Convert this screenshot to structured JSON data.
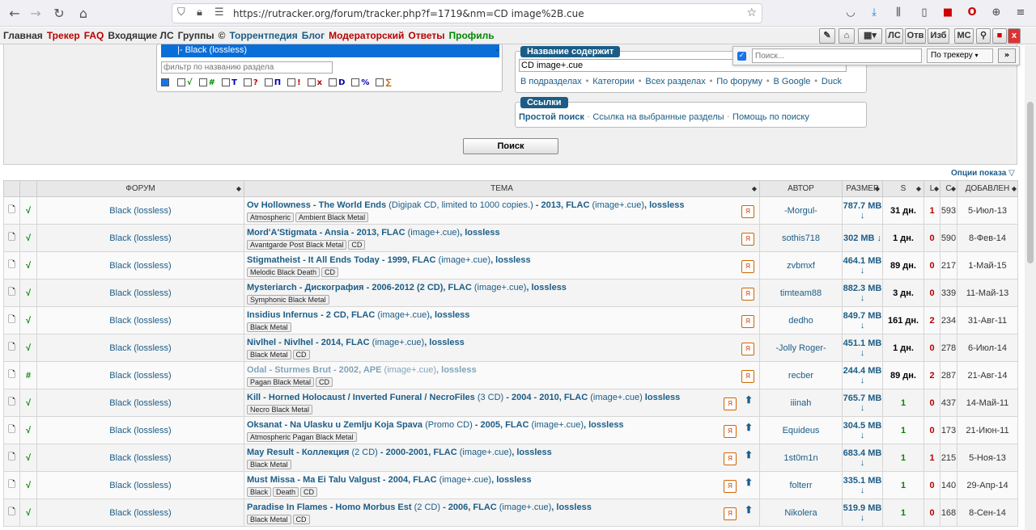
{
  "browser": {
    "url": "https://rutracker.org/forum/tracker.php?f=1719&nm=CD image%2B.cue"
  },
  "menu": {
    "items": [
      {
        "label": "Главная",
        "color": "#333"
      },
      {
        "label": "Трекер",
        "color": "#b00"
      },
      {
        "label": "FAQ",
        "color": "#b00"
      },
      {
        "label": "Входящие ЛС",
        "color": "#333"
      },
      {
        "label": "Группы",
        "color": "#333"
      },
      {
        "label": "©",
        "color": "#333"
      },
      {
        "label": "Торрентпедия",
        "color": "#1b5d87"
      },
      {
        "label": "Блог",
        "color": "#1b5d87"
      },
      {
        "label": "Модераторский",
        "color": "#b00"
      },
      {
        "label": "Ответы",
        "color": "#b00"
      },
      {
        "label": "Профиль",
        "color": "#080"
      }
    ],
    "buttons": [
      "ЛС",
      "Отв",
      "Изб",
      "МС"
    ]
  },
  "popup": {
    "placeholder": "Поиск...",
    "scope": "По трекеру",
    "go": "»"
  },
  "search": {
    "selected_forum": "|- Black (lossless)",
    "filter_placeholder": "фильтр по названию раздела",
    "flags": [
      {
        "sym": "*",
        "color": "#b00"
      },
      {
        "sym": "√",
        "color": "#080"
      },
      {
        "sym": "#",
        "color": "#080"
      },
      {
        "sym": "T",
        "color": "#00a"
      },
      {
        "sym": "?",
        "color": "#b00"
      },
      {
        "sym": "П",
        "color": "#00a"
      },
      {
        "sym": "!",
        "color": "#b00"
      },
      {
        "sym": "x",
        "color": "#b00"
      },
      {
        "sym": "D",
        "color": "#00a"
      },
      {
        "sym": "%",
        "color": "#00a"
      },
      {
        "sym": "∑",
        "color": "#c60"
      }
    ],
    "title_legend": "Название содержит",
    "title_value": "CD image+.cue",
    "title_links": [
      "В подразделах",
      "Категории",
      "Всех разделах",
      "По форуму",
      "В Google",
      "Duck"
    ],
    "links_legend": "Ссылки",
    "simple_search": "Простой поиск",
    "link2": "Ссылка на выбранные разделы",
    "link3": "Помощь по поиску",
    "submit": "Поиск",
    "options": "Опции показа"
  },
  "table": {
    "headers": {
      "forum": "ФОРУМ",
      "topic": "ТЕМА",
      "author": "АВТОР",
      "size": "РАЗМЕР",
      "s": "S",
      "l": "L",
      "c": "C",
      "added": "ДОБАВЛЕН"
    },
    "rows": [
      {
        "check": "√",
        "forum": "Black (lossless)",
        "title": "Ov Hollowness - The World Ends",
        "extra": " (Digipak CD, limited to 1000 copies.)",
        "tail": " - 2013, FLAC ",
        "fmt": "(image+.cue)",
        "q": ", lossless",
        "tags": [
          "Atmospheric",
          "Ambient Black Metal"
        ],
        "up": false,
        "author": "-Morgul-",
        "size": "787.7 MB ↓",
        "seed": "31 дн.",
        "leech": "1",
        "comp": "593",
        "added": "5-Июл-13",
        "seedcolor": "#000"
      },
      {
        "check": "√",
        "forum": "Black (lossless)",
        "title": "Mord'A'Stigmata - Ansia",
        "extra": "",
        "tail": " - 2013, FLAC ",
        "fmt": "(image+.cue)",
        "q": ", lossless",
        "tags": [
          "Avantgarde Post Black Metal",
          "CD"
        ],
        "up": false,
        "author": "sothis718",
        "size": "302 MB ↓",
        "seed": "1 дн.",
        "leech": "0",
        "comp": "590",
        "added": "8-Фев-14",
        "seedcolor": "#000"
      },
      {
        "check": "√",
        "forum": "Black (lossless)",
        "title": "Stigmatheist - It All Ends Today",
        "extra": "",
        "tail": " - 1999, FLAC ",
        "fmt": "(image+.cue)",
        "q": ", lossless",
        "tags": [
          "Melodic Black Death",
          "CD"
        ],
        "up": false,
        "author": "zvbmxf",
        "size": "464.1 MB ↓",
        "seed": "89 дн.",
        "leech": "0",
        "comp": "217",
        "added": "1-Май-15",
        "seedcolor": "#000"
      },
      {
        "check": "√",
        "forum": "Black (lossless)",
        "title": "Mysteriarch - Дискография",
        "extra": "",
        "tail": " - 2006-2012 (2 CD), FLAC ",
        "fmt": "(image+.cue)",
        "q": ", lossless",
        "tags": [
          "Symphonic Black Metal"
        ],
        "up": false,
        "author": "timteam88",
        "size": "882.3 MB ↓",
        "seed": "3 дн.",
        "leech": "0",
        "comp": "339",
        "added": "11-Май-13",
        "seedcolor": "#000"
      },
      {
        "check": "√",
        "forum": "Black (lossless)",
        "title": "Insidius Infernus - 2 CD, FLAC",
        "extra": "",
        "tail": " ",
        "fmt": "(image+.cue)",
        "q": ", lossless",
        "tags": [
          "Black Metal"
        ],
        "up": false,
        "author": "dedho",
        "size": "849.7 MB ↓",
        "seed": "161 дн.",
        "leech": "2",
        "comp": "234",
        "added": "31-Авг-11",
        "seedcolor": "#000"
      },
      {
        "check": "√",
        "forum": "Black (lossless)",
        "title": "Nivlhel - Nivlhel",
        "extra": "",
        "tail": " - 2014, FLAC ",
        "fmt": "(image+.cue)",
        "q": ", lossless",
        "tags": [
          "Black Metal",
          "CD"
        ],
        "up": false,
        "author": "-Jolly Roger-",
        "size": "451.1 MB ↓",
        "seed": "1 дн.",
        "leech": "0",
        "comp": "278",
        "added": "6-Июл-14",
        "seedcolor": "#000"
      },
      {
        "check": "#",
        "forum": "Black (lossless)",
        "title": "Odal - Sturmes Brut",
        "extra": "",
        "tail": " - 2002, APE ",
        "fmt": "(image+.cue)",
        "q": ", lossless",
        "tags": [
          "Pagan Black Metal",
          "CD"
        ],
        "up": false,
        "author": "recber",
        "size": "244.4 MB ↓",
        "seed": "89 дн.",
        "leech": "2",
        "comp": "287",
        "added": "21-Авг-14",
        "seedcolor": "#000",
        "faded": true
      },
      {
        "check": "√",
        "forum": "Black (lossless)",
        "title": "Kill - Horned Holocaust / Inverted Funeral / NecroFiles",
        "extra": " (3 CD)",
        "tail": " - 2004 - 2010, FLAC ",
        "fmt": "(image+.cue)",
        "q": " lossless",
        "tags": [
          "Necro Black Metal"
        ],
        "up": true,
        "author": "iiinah",
        "size": "765.7 MB ↓",
        "seed": "1",
        "leech": "0",
        "comp": "437",
        "added": "14-Май-11",
        "seedcolor": "#080"
      },
      {
        "check": "√",
        "forum": "Black (lossless)",
        "title": "Oksanat - Na Ulasku u Zemlju Koja Spava",
        "extra": " (Promo CD)",
        "tail": " - 2005, FLAC ",
        "fmt": "(image+.cue)",
        "q": ", lossless",
        "tags": [
          "Atmospheric Pagan Black Metal"
        ],
        "up": true,
        "author": "Equideus",
        "size": "304.5 MB ↓",
        "seed": "1",
        "leech": "0",
        "comp": "173",
        "added": "21-Июн-11",
        "seedcolor": "#080"
      },
      {
        "check": "√",
        "forum": "Black (lossless)",
        "title": "May Result - Коллекция",
        "extra": " (2 CD)",
        "tail": " - 2000-2001, FLAC ",
        "fmt": "(image+.cue)",
        "q": ", lossless",
        "tags": [
          "Black Metal"
        ],
        "up": true,
        "author": "1st0m1n",
        "size": "683.4 MB ↓",
        "seed": "1",
        "leech": "1",
        "comp": "215",
        "added": "5-Ноя-13",
        "seedcolor": "#080"
      },
      {
        "check": "√",
        "forum": "Black (lossless)",
        "title": "Must Missa - Ma Ei Talu Valgust",
        "extra": "",
        "tail": " - 2004, FLAC ",
        "fmt": "(image+.cue)",
        "q": ", lossless",
        "tags": [
          "Black",
          "Death",
          "CD"
        ],
        "up": true,
        "author": "folterr",
        "size": "335.1 MB ↓",
        "seed": "1",
        "leech": "0",
        "comp": "140",
        "added": "29-Апр-14",
        "seedcolor": "#080"
      },
      {
        "check": "√",
        "forum": "Black (lossless)",
        "title": "Paradise In Flames - Homo Morbus Est",
        "extra": " (2 CD)",
        "tail": " - 2006, FLAC ",
        "fmt": "(image+.cue)",
        "q": ", lossless",
        "tags": [
          "Black Metal",
          "CD"
        ],
        "up": true,
        "author": "Nikolera",
        "size": "519.9 MB ↓",
        "seed": "1",
        "leech": "0",
        "comp": "168",
        "added": "8-Сен-14",
        "seedcolor": "#080"
      }
    ]
  }
}
